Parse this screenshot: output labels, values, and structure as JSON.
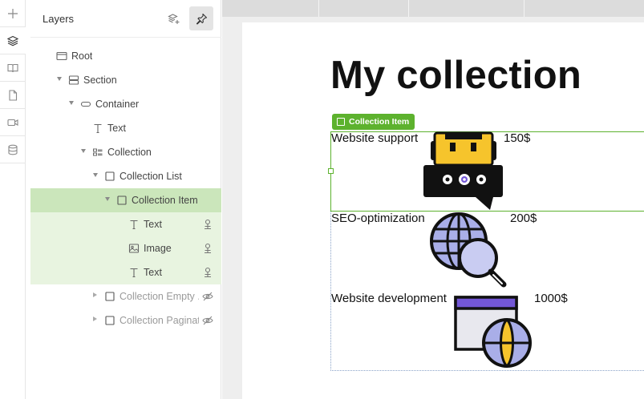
{
  "rail": {
    "items": [
      {
        "name": "add-icon"
      },
      {
        "name": "layers-icon",
        "active": true
      },
      {
        "name": "book-icon"
      },
      {
        "name": "page-icon"
      },
      {
        "name": "video-icon"
      },
      {
        "name": "database-icon"
      }
    ]
  },
  "layers_panel": {
    "title": "Layers",
    "add_layer_icon": "layers-plus-icon",
    "pin_icon": "pin-icon"
  },
  "tree": [
    {
      "label": "Root",
      "depth": 0,
      "caret": "none",
      "icon": "frame-icon",
      "state": "normal"
    },
    {
      "label": "Section",
      "depth": 1,
      "caret": "down",
      "icon": "section-icon",
      "state": "normal"
    },
    {
      "label": "Container",
      "depth": 2,
      "caret": "down",
      "icon": "container-icon",
      "state": "normal"
    },
    {
      "label": "Text",
      "depth": 3,
      "caret": "none",
      "icon": "text-icon",
      "state": "normal"
    },
    {
      "label": "Collection",
      "depth": 3,
      "caret": "down",
      "icon": "collection-icon",
      "state": "normal"
    },
    {
      "label": "Collection List",
      "depth": 4,
      "caret": "down",
      "icon": "box-icon",
      "state": "normal"
    },
    {
      "label": "Collection Item",
      "depth": 5,
      "caret": "down",
      "icon": "box-icon",
      "state": "selected"
    },
    {
      "label": "Text",
      "depth": 6,
      "caret": "none",
      "icon": "text-icon",
      "state": "child",
      "trail": "bind-icon"
    },
    {
      "label": "Image",
      "depth": 6,
      "caret": "none",
      "icon": "image-icon",
      "state": "child",
      "trail": "bind-icon"
    },
    {
      "label": "Text",
      "depth": 6,
      "caret": "none",
      "icon": "text-icon",
      "state": "child",
      "trail": "bind-icon"
    },
    {
      "label": "Collection Empty ...",
      "depth": 4,
      "caret": "right",
      "icon": "box-icon",
      "state": "dim",
      "trail": "eye-off-icon"
    },
    {
      "label": "Collection Paginat...",
      "depth": 4,
      "caret": "right",
      "icon": "box-icon",
      "state": "dim",
      "trail": "eye-off-icon"
    }
  ],
  "canvas": {
    "heading": "My collection",
    "badge": "Collection Item",
    "items": [
      {
        "name": "Website support",
        "price": "150$",
        "image": "robot-chat-icon"
      },
      {
        "name": "SEO-optimization",
        "price": "200$",
        "image": "globe-search-icon"
      },
      {
        "name": "Website development",
        "price": "1000$",
        "image": "browser-globe-icon"
      }
    ]
  },
  "colors": {
    "accent_green": "#5db22e",
    "selected_row": "#cbe6bb",
    "child_row": "#e8f4e0",
    "icon_yellow": "#f6c42c",
    "icon_lavender": "#a9aee8",
    "icon_purple": "#7357d6"
  }
}
